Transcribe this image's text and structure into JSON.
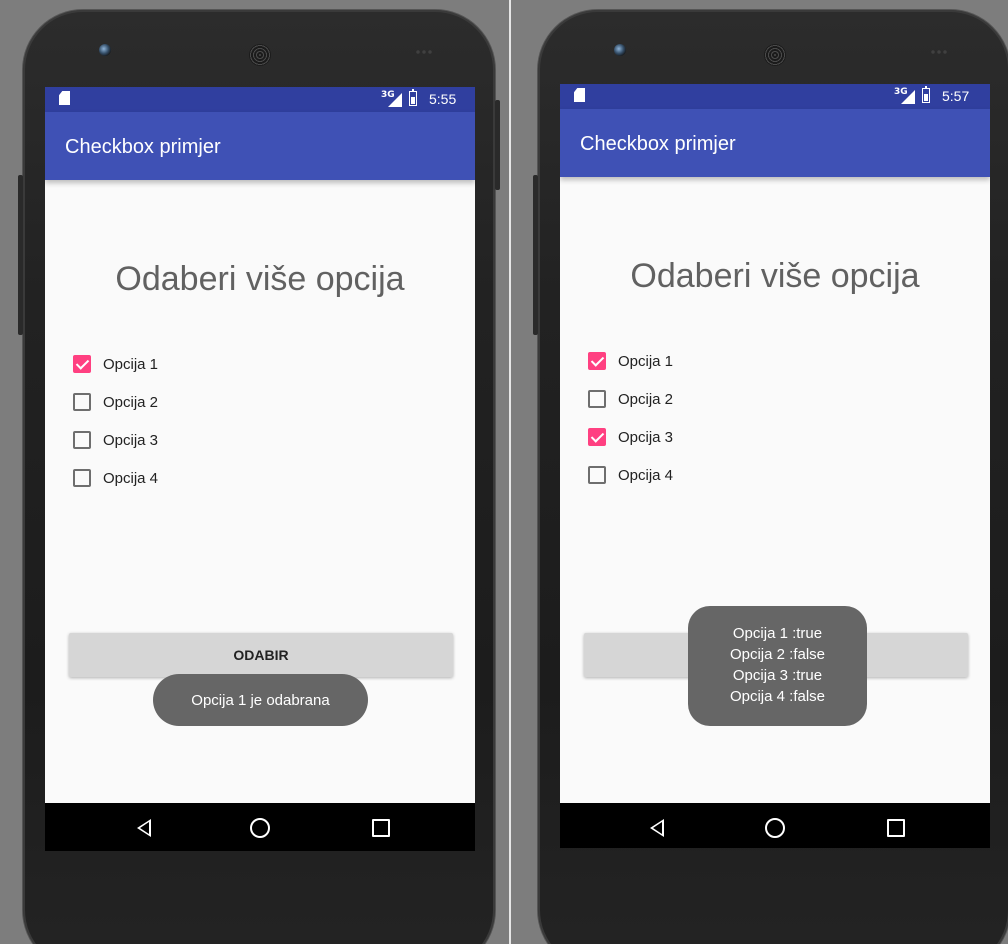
{
  "screens": [
    {
      "status": {
        "network": "3G",
        "time": "5:55"
      },
      "app_title": "Checkbox primjer",
      "heading": "Odaberi više opcija",
      "checkboxes": [
        {
          "label": "Opcija 1",
          "checked": true
        },
        {
          "label": "Opcija 2",
          "checked": false
        },
        {
          "label": "Opcija 3",
          "checked": false
        },
        {
          "label": "Opcija 4",
          "checked": false
        }
      ],
      "button_label": "ODABIR",
      "toast": {
        "lines": [
          "Opcija 1 je odabrana"
        ]
      }
    },
    {
      "status": {
        "network": "3G",
        "time": "5:57"
      },
      "app_title": "Checkbox primjer",
      "heading": "Odaberi više opcija",
      "checkboxes": [
        {
          "label": "Opcija 1",
          "checked": true
        },
        {
          "label": "Opcija 2",
          "checked": false
        },
        {
          "label": "Opcija 3",
          "checked": true
        },
        {
          "label": "Opcija 4",
          "checked": false
        }
      ],
      "button_label": "ODABIR",
      "toast": {
        "lines": [
          "Opcija 1 :true",
          "Opcija 2 :false",
          "Opcija 3 :true",
          "Opcija 4 :false"
        ]
      }
    }
  ],
  "colors": {
    "status_bar": "#303f9f",
    "app_bar": "#3f51b5",
    "checkbox_accent": "#ff4081",
    "toast_bg": "#666666"
  },
  "icons": {
    "status_left": "sd-card-icon",
    "signal": "signal-icon",
    "battery": "battery-icon",
    "nav": [
      "back-icon",
      "home-icon",
      "recents-icon"
    ]
  }
}
